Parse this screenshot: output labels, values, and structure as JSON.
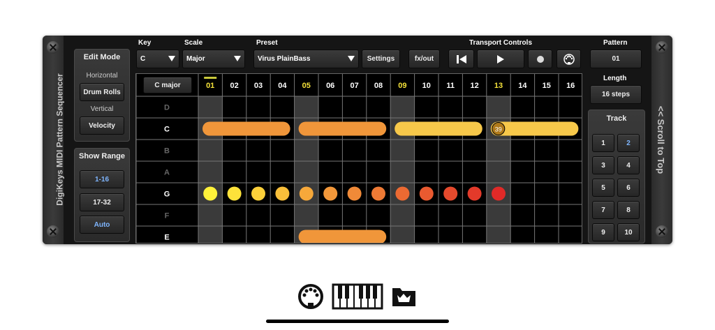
{
  "app": {
    "title": "DigiKeys MIDI Pattern Sequencer",
    "scroll_label": "<< Scroll to Top"
  },
  "edit_mode": {
    "heading": "Edit Mode",
    "horizontal_label": "Horizontal",
    "horizontal_value": "Drum Rolls",
    "vertical_label": "Vertical",
    "vertical_value": "Velocity"
  },
  "show_range": {
    "heading": "Show Range",
    "options": [
      "1-16",
      "17-32",
      "Auto"
    ],
    "active": [
      "1-16",
      "Auto"
    ]
  },
  "toolbar": {
    "key_label": "Key",
    "key_value": "C",
    "scale_label": "Scale",
    "scale_value": "Major",
    "preset_label": "Preset",
    "preset_value": "Virus PlainBass",
    "settings_label": "Settings",
    "fx_label": "fx/out",
    "transport_label": "Transport Controls"
  },
  "pattern": {
    "label": "Pattern",
    "value": "01",
    "length_label": "Length",
    "length_value": "16 steps"
  },
  "track": {
    "label": "Track",
    "buttons": [
      "1",
      "2",
      "3",
      "4",
      "5",
      "6",
      "7",
      "8",
      "9",
      "10"
    ],
    "selected": "2"
  },
  "grid": {
    "scale_name": "C major",
    "steps": [
      "01",
      "02",
      "03",
      "04",
      "05",
      "06",
      "07",
      "08",
      "09",
      "10",
      "11",
      "12",
      "13",
      "14",
      "15",
      "16"
    ],
    "highlight_steps": [
      1,
      5,
      9,
      13
    ],
    "current_step": 1,
    "rows": [
      {
        "note": "D",
        "in_scale": false
      },
      {
        "note": "C",
        "in_scale": true
      },
      {
        "note": "B",
        "in_scale": false
      },
      {
        "note": "A",
        "in_scale": false
      },
      {
        "note": "G",
        "in_scale": true
      },
      {
        "note": "F",
        "in_scale": false
      },
      {
        "note": "E",
        "in_scale": true
      }
    ],
    "long_notes": [
      {
        "row": 1,
        "start": 1,
        "end": 4,
        "color": "#f0963a"
      },
      {
        "row": 1,
        "start": 5,
        "end": 8,
        "color": "#f0963a"
      },
      {
        "row": 1,
        "start": 9,
        "end": 12,
        "color": "#f7c84a"
      },
      {
        "row": 1,
        "start": 13,
        "end": 16,
        "color": "#f7c84a",
        "badge": "39"
      },
      {
        "row": 6,
        "start": 5,
        "end": 8,
        "color": "#f0963a"
      }
    ],
    "dots": [
      {
        "row": 4,
        "step": 1,
        "color": "#fff23a"
      },
      {
        "row": 4,
        "step": 2,
        "color": "#fde23a"
      },
      {
        "row": 4,
        "step": 3,
        "color": "#fbd03a"
      },
      {
        "row": 4,
        "step": 4,
        "color": "#f9bf3a"
      },
      {
        "row": 4,
        "step": 5,
        "color": "#f6a83a"
      },
      {
        "row": 4,
        "step": 6,
        "color": "#f3983a"
      },
      {
        "row": 4,
        "step": 7,
        "color": "#f08a38"
      },
      {
        "row": 4,
        "step": 8,
        "color": "#ee7a35"
      },
      {
        "row": 4,
        "step": 9,
        "color": "#ec6a32"
      },
      {
        "row": 4,
        "step": 10,
        "color": "#e95a30"
      },
      {
        "row": 4,
        "step": 11,
        "color": "#e64a2d"
      },
      {
        "row": 4,
        "step": 12,
        "color": "#e33a2a"
      },
      {
        "row": 4,
        "step": 13,
        "color": "#e02a28"
      }
    ]
  },
  "dock": {
    "icons": [
      "midi-connector-icon",
      "piano-keyboard-icon",
      "open-folder-icon"
    ]
  }
}
